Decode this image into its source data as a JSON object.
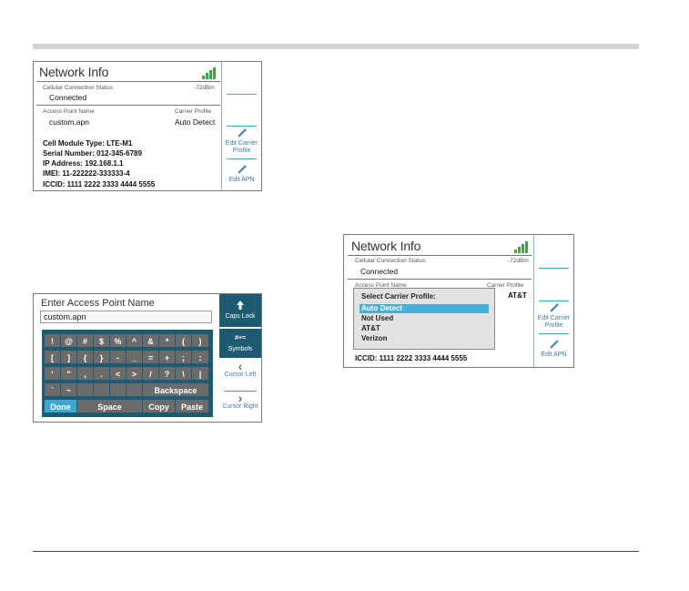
{
  "screen1": {
    "title": "Network Info",
    "status_label": "Cellular Connection Status",
    "signal_dbm": "-72dBm",
    "status_value": "Connected",
    "apn_label": "Access Point Name",
    "carrier_label": "Carrier Profile",
    "apn_value": "custom.apn",
    "carrier_value": "Auto Detect",
    "info": [
      "Cell Module Type: LTE-M1",
      "Serial Number: 012-345-6789",
      "IP Address: 192.168.1.1",
      "IMEI: 11-222222-333333-4",
      "ICCID: 1111 2222 3333 4444 5555"
    ],
    "side_buttons": {
      "edit_carrier": "Edit Carrier Profile",
      "edit_apn": "Edit APN"
    }
  },
  "screen2": {
    "title": "Network Info",
    "status_label": "Cellular Connection Status:",
    "signal_dbm": "-72dBm",
    "status_value": "Connected",
    "apn_label": "Access Point Name",
    "carrier_label": "Carrier Profile",
    "carrier_value": "AT&T",
    "popup_title": "Select Carrier Profile:",
    "options": [
      "Auto Detect",
      "Not Used",
      "AT&T",
      "Verizon"
    ],
    "selected_index": 0,
    "iccid": "ICCID: 1111 2222 3333 4444 5555",
    "side_buttons": {
      "edit_carrier": "Edit Carrier Profile",
      "edit_apn": "Edit APN"
    }
  },
  "keyboard": {
    "title": "Enter Access Point Name",
    "input_value": "custom.apn",
    "rows": [
      [
        "!",
        "@",
        "#",
        "$",
        "%",
        "^",
        "&",
        "*",
        "(",
        ")"
      ],
      [
        "[",
        "]",
        "{",
        "}",
        "-",
        "_",
        "=",
        "+",
        ";",
        ":"
      ],
      [
        "'",
        "\"",
        ",",
        ".",
        "<",
        ">",
        "/",
        "?",
        "\\",
        "|"
      ],
      [
        "`",
        "~"
      ]
    ],
    "backspace": "Backspace",
    "done": "Done",
    "space": "Space",
    "copy": "Copy",
    "paste": "Paste",
    "side": {
      "caps_lock": "Caps Lock",
      "symbols_icon": "#+=",
      "symbols": "Symbols",
      "cursor_left": "Cursor Left",
      "cursor_right": "Cursor Right"
    }
  },
  "colors": {
    "accent": "#3a7fa8",
    "keyboard_bg": "#1d5b72",
    "selection": "#46b0dc",
    "signal": "#46a046"
  }
}
